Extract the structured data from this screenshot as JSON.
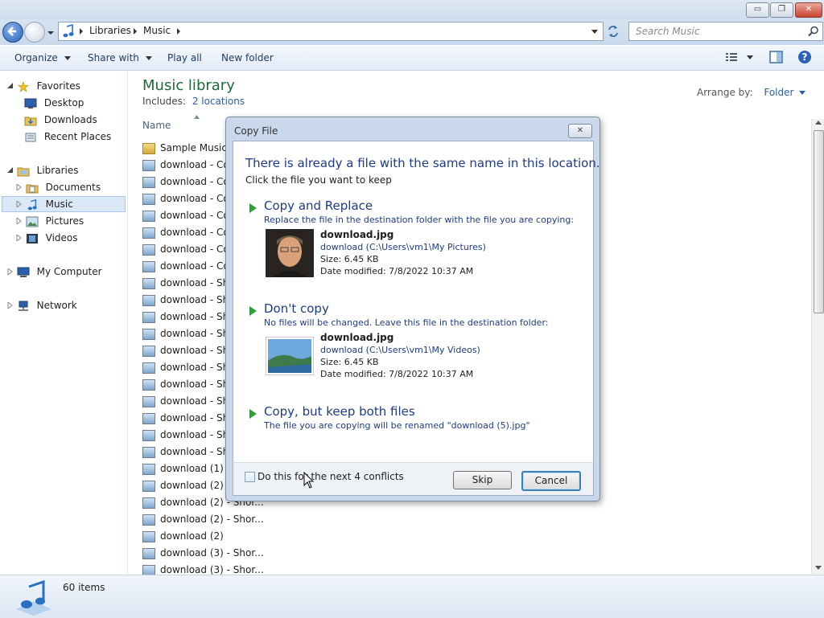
{
  "window": {
    "minimize_glyph": "▭",
    "maximize_glyph": "❐",
    "close_glyph": "✕"
  },
  "address": {
    "crumbs": [
      "Libraries",
      "Music"
    ],
    "search_placeholder": "Search Music"
  },
  "commands": {
    "organize": "Organize",
    "share_with": "Share with",
    "play_all": "Play all",
    "new_folder": "New folder"
  },
  "nav": {
    "favorites": "Favorites",
    "desktop": "Desktop",
    "downloads": "Downloads",
    "recent_places": "Recent Places",
    "libraries": "Libraries",
    "documents": "Documents",
    "music": "Music",
    "pictures": "Pictures",
    "videos": "Videos",
    "my_computer": "My Computer",
    "network": "Network"
  },
  "library": {
    "title": "Music library",
    "includes_label": "Includes:",
    "locations_link": "2 locations",
    "arrange_label": "Arrange by:",
    "arrange_value": "Folder",
    "column_name": "Name"
  },
  "files": [
    "Sample Music",
    "download - Co",
    "download - Co",
    "download - Co",
    "download - Co",
    "download - Co",
    "download - Co",
    "download - Co",
    "download - Sho",
    "download - Sho",
    "download - Sho",
    "download - Sho",
    "download - Sho",
    "download - Sho",
    "download - Sho",
    "download - Sho",
    "download - Sho",
    "download - Sho",
    "download - Sho",
    "download (1)",
    "download (2) -",
    "download (2) - Shor...",
    "download (2) - Shor...",
    "download (2)",
    "download (3) - Shor...",
    "download (3) - Shor..."
  ],
  "status": {
    "item_count": "60 items"
  },
  "dialog": {
    "title": "Copy File",
    "heading": "There is already a file with the same name in this location.",
    "subheading": "Click the file you want to keep",
    "option1": {
      "title": "Copy and Replace",
      "desc": "Replace the file in the destination folder with the file you are copying:",
      "file_name": "download.jpg",
      "file_path": "download (C:\\Users\\vm1\\My Pictures)",
      "file_size": "Size: 6.45 KB",
      "file_date": "Date modified: 7/8/2022 10:37 AM"
    },
    "option2": {
      "title": "Don't copy",
      "desc": "No files will be changed. Leave this file in the destination folder:",
      "file_name": "download.jpg",
      "file_path": "download (C:\\Users\\vm1\\My Videos)",
      "file_size": "Size: 6.45 KB",
      "file_date": "Date modified: 7/8/2022 10:37 AM"
    },
    "option3": {
      "title": "Copy, but keep both files",
      "desc": "The file you are copying will be renamed \"download (5).jpg\""
    },
    "checkbox_label": "Do this for the next 4 conflicts",
    "skip": "Skip",
    "cancel": "Cancel"
  }
}
